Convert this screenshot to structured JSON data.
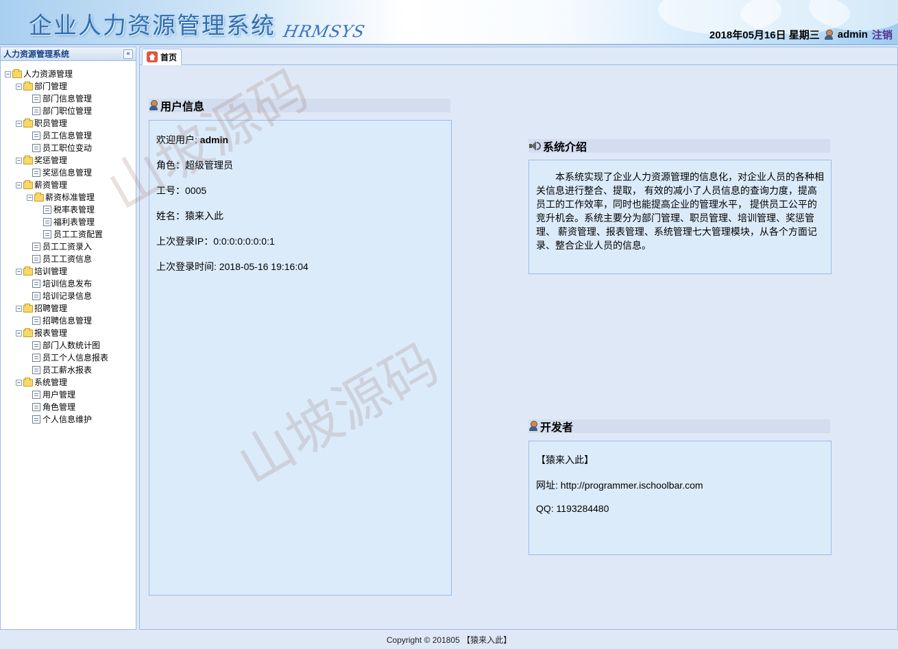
{
  "header": {
    "title": "企业人力资源管理系统",
    "subtitle": "HRMSYS",
    "date": "2018年05月16日 星期三",
    "username": "admin",
    "logout_label": "注销"
  },
  "sidebar": {
    "title": "人力资源管理系统",
    "tree": [
      {
        "label": "人力资源管理",
        "level": 0,
        "type": "folder"
      },
      {
        "label": "部门管理",
        "level": 1,
        "type": "folder"
      },
      {
        "label": "部门信息管理",
        "level": 2,
        "type": "leaf"
      },
      {
        "label": "部门职位管理",
        "level": 2,
        "type": "leaf"
      },
      {
        "label": "职员管理",
        "level": 1,
        "type": "folder"
      },
      {
        "label": "员工信息管理",
        "level": 2,
        "type": "leaf"
      },
      {
        "label": "员工职位变动",
        "level": 2,
        "type": "leaf"
      },
      {
        "label": "奖惩管理",
        "level": 1,
        "type": "folder"
      },
      {
        "label": "奖惩信息管理",
        "level": 2,
        "type": "leaf"
      },
      {
        "label": "薪资管理",
        "level": 1,
        "type": "folder"
      },
      {
        "label": "薪资标准管理",
        "level": 2,
        "type": "folder"
      },
      {
        "label": "税率表管理",
        "level": 3,
        "type": "leaf"
      },
      {
        "label": "福利表管理",
        "level": 3,
        "type": "leaf"
      },
      {
        "label": "员工工资配置",
        "level": 3,
        "type": "leaf"
      },
      {
        "label": "员工工资录入",
        "level": 2,
        "type": "leaf"
      },
      {
        "label": "员工工资信息",
        "level": 2,
        "type": "leaf"
      },
      {
        "label": "培训管理",
        "level": 1,
        "type": "folder"
      },
      {
        "label": "培训信息发布",
        "level": 2,
        "type": "leaf"
      },
      {
        "label": "培训记录信息",
        "level": 2,
        "type": "leaf"
      },
      {
        "label": "招聘管理",
        "level": 1,
        "type": "folder"
      },
      {
        "label": "招聘信息管理",
        "level": 2,
        "type": "leaf"
      },
      {
        "label": "报表管理",
        "level": 1,
        "type": "folder"
      },
      {
        "label": "部门人数统计图",
        "level": 2,
        "type": "leaf"
      },
      {
        "label": "员工个人信息报表",
        "level": 2,
        "type": "leaf"
      },
      {
        "label": "员工薪水报表",
        "level": 2,
        "type": "leaf"
      },
      {
        "label": "系统管理",
        "level": 1,
        "type": "folder"
      },
      {
        "label": "用户管理",
        "level": 2,
        "type": "leaf"
      },
      {
        "label": "角色管理",
        "level": 2,
        "type": "leaf"
      },
      {
        "label": "个人信息维护",
        "level": 2,
        "type": "leaf"
      }
    ]
  },
  "tabs": [
    {
      "label": "首页"
    }
  ],
  "user_info": {
    "title": "用户信息",
    "welcome_label": "欢迎用户:",
    "welcome_value": "admin",
    "role": "角色：超级管理员",
    "employee_id": "工号：0005",
    "name": "姓名：猿来入此",
    "last_ip": "上次登录IP：0:0:0:0:0:0:0:1",
    "last_login": "上次登录时间: 2018-05-16 19:16:04"
  },
  "intro": {
    "title": "系统介绍",
    "text": "本系统实现了企业人力资源管理的信息化，对企业人员的各种相关信息进行整合、提取， 有效的减小了人员信息的查询力度，提高员工的工作效率，同时也能提高企业的管理水平， 提供员工公平的竞升机会。系统主要分为部门管理、职员管理、培训管理、奖惩管理、 薪资管理、报表管理、系统管理七大管理模块，从各个方面记录、整合企业人员的信息。"
  },
  "developer": {
    "title": "开发者",
    "name": "【猿来入此】",
    "website": "网址: http://programmer.ischoolbar.com",
    "qq": "QQ: 1193284480"
  },
  "watermark": "山坡源码",
  "footer": "Copyright © 201805 【猿来入此】",
  "icons": {
    "collapse": "double-chevron-left-icon",
    "home": "home-icon",
    "user": "user-icon",
    "speaker": "speaker-icon"
  }
}
